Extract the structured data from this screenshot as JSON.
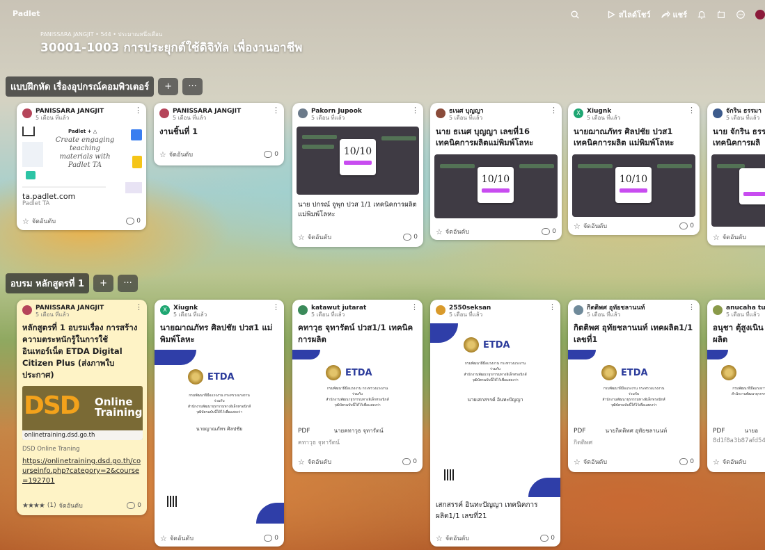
{
  "app": {
    "brand": "Padlet"
  },
  "toolbar": {
    "slideshow": "สไลด์โชว์",
    "share": "แชร์"
  },
  "board": {
    "breadcrumb": "PANISSARA JANGJIT • 544 • ประมาณหนึ่งเดือน",
    "title": "30001-1003 การประยุกต์ใช้ดิจิทัล เพื่องานอาชีพ"
  },
  "common": {
    "time": "5 เดือน ที่แล้ว",
    "rank": "จัดอันดับ",
    "comments": "0",
    "pdf": "PDF",
    "add": "+",
    "more": "···"
  },
  "sections": [
    {
      "title": "แบบฝึกหัด เรื่องอุปกรณ์คอมพิวเตอร์",
      "cards": [
        {
          "author": "PANISSARA JANGJIT",
          "preview_brand": "Padlet + △",
          "preview_text": "Create engaging teaching materials with Padlet TA",
          "domain": "ta.padlet.com",
          "source": "Padlet TA"
        },
        {
          "author": "PANISSARA JANGJIT",
          "title": "งานชิ้นที่ 1"
        },
        {
          "author": "Pakorn Jupook",
          "score": "10/10",
          "caption": "นาย ปกรณ์ จูพุก ปวส 1/1 เทคนิคการผลิต แม่พิมพ์โลหะ"
        },
        {
          "author": "ธเนศ บุญญา",
          "title": "นาย ธเนศ บุญญา เลขที่16 เทคนิคการผลิตแม่พิมพ์โลหะ",
          "score": "10/10"
        },
        {
          "author": "Xiugnk",
          "title": "นายฌาณภัทร ศิลปชัย ปวส1 เทคนิคการผลิต แม่พิมพ์โลหะ",
          "score": "10/10"
        },
        {
          "author": "จักริน ธรรมา",
          "title": "นาย จักริน ธรร เทคนิคการผลิ"
        }
      ]
    },
    {
      "title": "อบรม หลักสูตรที่ 1",
      "cards": [
        {
          "author": "PANISSARA JANGJIT",
          "title": "หลักสูตรที่ 1 อบรมเรื่อง การสร้างความตระหนักรู้ในการใช้อินเทอร์เน็ต ETDA Digital Citizen Plus (ส่งภาพใบประกาศ)",
          "banner_big": "DSD",
          "banner_small1": "Online",
          "banner_small2": "Training",
          "domain": "onlinetraining.dsd.go.th",
          "source": "DSD Online Traning",
          "link": "https://onlinetraining.dsd.go.th/courseinfo.php?category=2&course=192701",
          "rating_count": "(1)",
          "rating": 4
        },
        {
          "author": "Xiugnk",
          "title": "นายฌาณภัทร ศิลปชัย ปวส1 แม่พิมพ์โลหะ",
          "cert_name": "นายญาณภัทร ศิลปชัย"
        },
        {
          "author": "katawut jutarat",
          "title": "คทาวุธ จุทารัตน์ ปวส1/1 เทคนิคการผลิต",
          "cert_name": "นายคทาวุธ จุทารัตน์",
          "sub": "คทาวุธ จุทารัตน์"
        },
        {
          "author": "2550seksan",
          "cert_name": "นายเสกสรรค์ อินทะปัญญา",
          "caption": "เสกสรรค์ อินทะปัญญา เทคนิคการผลิต1/1 เลขที่21"
        },
        {
          "author": "กิตติพศ อุทัยชลานนท์",
          "title": "กิตติพศ อุทัยชลานนท์ เทคผลิต1/1 เลขที่1",
          "cert_name": "นายกิตติพศ อุทัยชลานนท์",
          "sub": "กิตติพศ"
        },
        {
          "author": "anucaha tu",
          "title": "อนุชา ตุ้สูงเนิน การผลิต",
          "cert_name": "นายอ",
          "sub": "8d1f8a3b87afd542"
        }
      ]
    }
  ],
  "cert": {
    "org": "กรมพัฒนาฝีมือแรงงาน กระทรวงแรงงาน",
    "given": "ร่วมกับ",
    "agency": "สำนักงานพัฒนาธุรกรรมทางอิเล็กทรอนิกส์",
    "award": "วุฒิบัตรฉบับนี้ให้ไว้เพื่อแสดงว่า",
    "brand": "ETDA"
  },
  "colors": {
    "section_bg": "#3c3c3c",
    "yellow_card": "#fef3c6",
    "cert_blue": "#2f3ea8",
    "purple": "#c84cf0"
  }
}
